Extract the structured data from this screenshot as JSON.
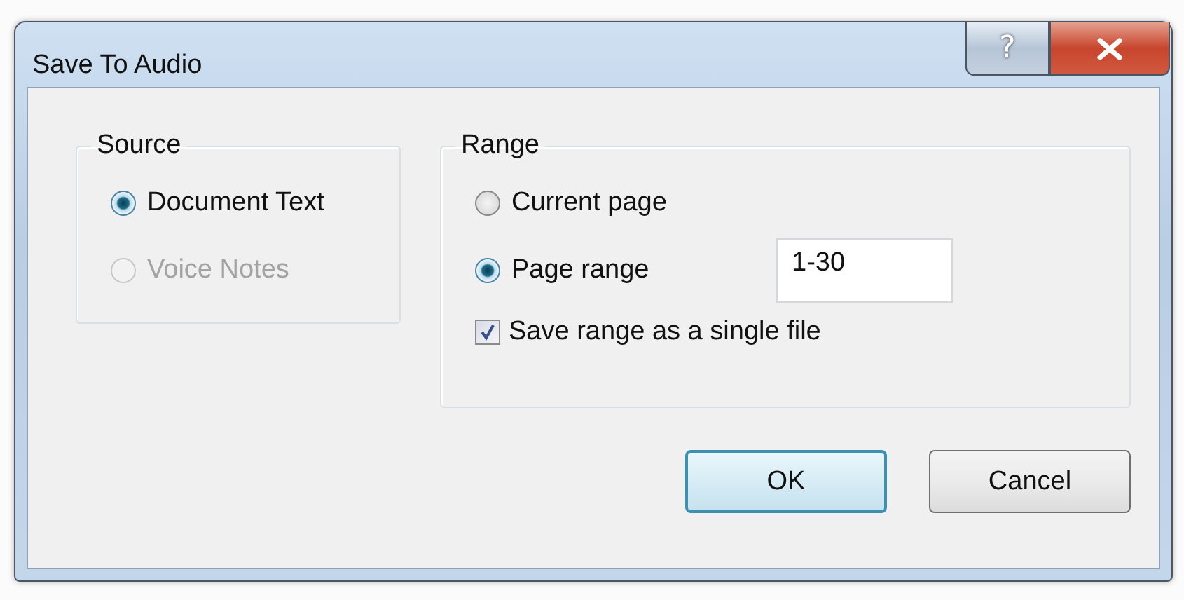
{
  "window": {
    "title": "Save To Audio"
  },
  "title_buttons": [
    {
      "kind": "help",
      "label": "?"
    },
    {
      "kind": "close"
    }
  ],
  "source": {
    "label": "Source",
    "options": [
      {
        "label": "Document Text",
        "selected": true,
        "disabled": false
      },
      {
        "label": "Voice Notes",
        "selected": false,
        "disabled": true
      }
    ]
  },
  "range": {
    "label": "Range",
    "options": [
      {
        "label": "Current page",
        "selected": false
      },
      {
        "label": "Page range",
        "selected": true,
        "field": {
          "value": "1-30"
        }
      }
    ],
    "single_file": {
      "label": "Save range as a single file",
      "checked": true
    }
  },
  "buttons": [
    {
      "label": "OK",
      "default": true
    },
    {
      "label": "Cancel",
      "default": false
    }
  ]
}
